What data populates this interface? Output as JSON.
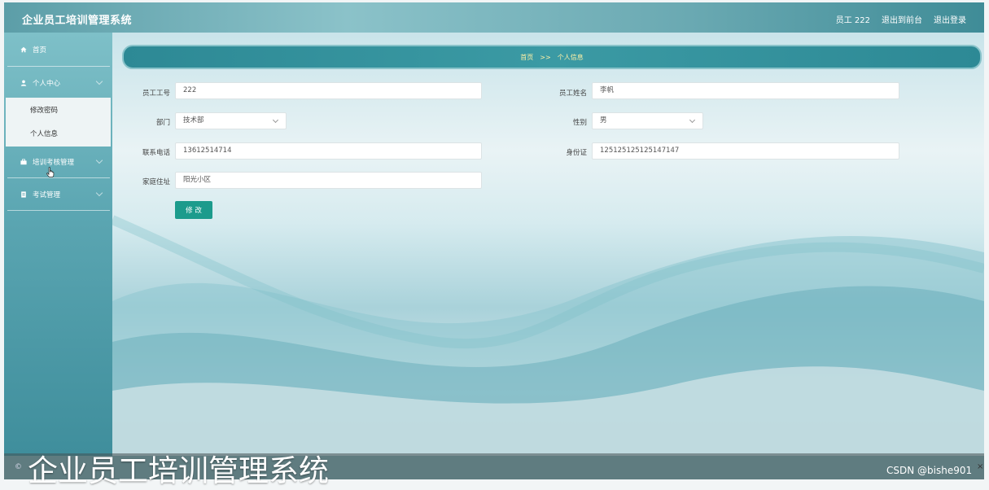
{
  "header": {
    "app_title": "企业员工培训管理系统",
    "user_label": "员工 222",
    "to_front_label": "退出到前台",
    "logout_label": "退出登录"
  },
  "sidebar": {
    "items": [
      {
        "label": "首页",
        "icon": "home-icon"
      },
      {
        "label": "个人中心",
        "icon": "user-icon"
      },
      {
        "label": "培训考核管理",
        "icon": "briefcase-icon"
      },
      {
        "label": "考试管理",
        "icon": "document-icon"
      }
    ],
    "submenu": [
      {
        "label": "修改密码"
      },
      {
        "label": "个人信息"
      }
    ]
  },
  "breadcrumb": {
    "home": "首页",
    "sep": ">>",
    "current": "个人信息"
  },
  "form": {
    "employee_id_label": "员工工号",
    "employee_id_value": "222",
    "employee_name_label": "员工姓名",
    "employee_name_value": "李帆",
    "department_label": "部门",
    "department_value": "技术部",
    "gender_label": "性别",
    "gender_value": "男",
    "phone_label": "联系电话",
    "phone_value": "13612514714",
    "id_card_label": "身份证",
    "id_card_value": "125125125125147147",
    "address_label": "家庭住址",
    "address_value": "阳光小区",
    "submit_label": "修 改"
  },
  "overlay": {
    "caption": "企业员工培训管理系统",
    "watermark": "CSDN @bishe901"
  },
  "colors": {
    "accent": "#1c9b8c",
    "header": "#5c9ea8",
    "breadcrumb": "#2d8995"
  }
}
